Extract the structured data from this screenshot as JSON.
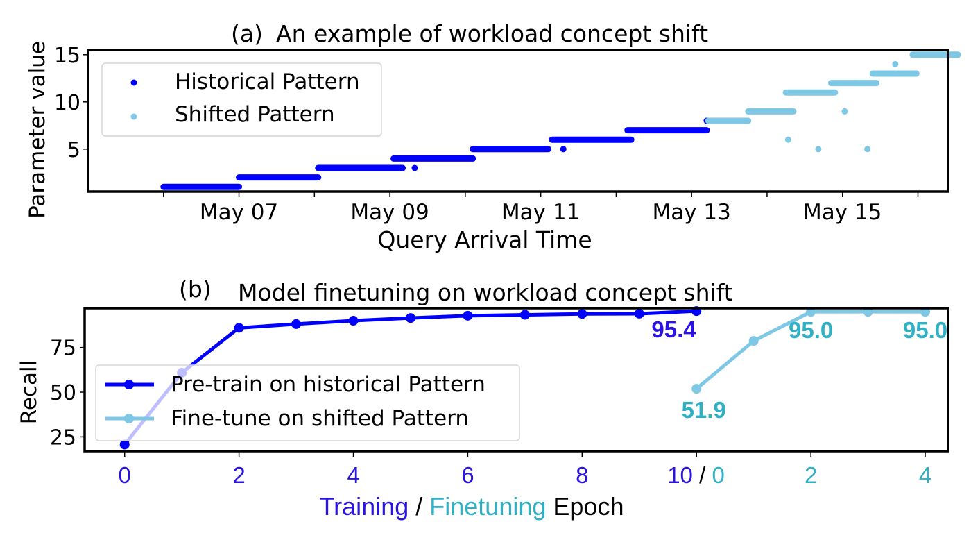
{
  "chart_data": [
    {
      "id": "a",
      "type": "scatter",
      "panel_label": "(a)",
      "title": "An example of workload concept shift",
      "xlabel": "Query Arrival Time",
      "ylabel": "Parameter value",
      "x_unit": "days since May 06",
      "xlim": [
        -1.0,
        10.4
      ],
      "ylim": [
        0.5,
        15.5
      ],
      "yticks": [
        5,
        10,
        15
      ],
      "xticks": [
        {
          "pos": 0,
          "label": ""
        },
        {
          "pos": 1,
          "label": "May 07"
        },
        {
          "pos": 2,
          "label": ""
        },
        {
          "pos": 3,
          "label": "May 09"
        },
        {
          "pos": 4,
          "label": ""
        },
        {
          "pos": 5,
          "label": "May 11"
        },
        {
          "pos": 6,
          "label": ""
        },
        {
          "pos": 7,
          "label": "May 13"
        },
        {
          "pos": 8,
          "label": ""
        },
        {
          "pos": 9,
          "label": "May 15"
        },
        {
          "pos": 10,
          "label": ""
        }
      ],
      "grid": false,
      "legend": {
        "position": "top-left",
        "entries": [
          {
            "label": "Historical Pattern",
            "color": "#0000ff"
          },
          {
            "label": "Shifted Pattern",
            "color": "#7ec8e6"
          }
        ]
      },
      "series": [
        {
          "name": "Historical Pattern",
          "color": "#0000ff",
          "segments": [
            {
              "x0": 0.0,
              "x1": 1.0,
              "y": 1
            },
            {
              "x0": 1.0,
              "x1": 2.05,
              "y": 2
            },
            {
              "x0": 2.05,
              "x1": 3.15,
              "y": 3
            },
            {
              "x0": 3.05,
              "x1": 4.1,
              "y": 4
            },
            {
              "x0": 4.1,
              "x1": 5.1,
              "y": 5
            },
            {
              "x0": 5.15,
              "x1": 6.2,
              "y": 6
            },
            {
              "x0": 6.15,
              "x1": 7.2,
              "y": 7
            },
            {
              "x0": 7.2,
              "x1": 7.22,
              "y": 8
            }
          ],
          "points": [
            {
              "x": 3.17,
              "y": 3
            },
            {
              "x": 3.33,
              "y": 3
            },
            {
              "x": 5.3,
              "y": 5
            }
          ]
        },
        {
          "name": "Shifted Pattern",
          "color": "#7ec8e6",
          "segments": [
            {
              "x0": 7.22,
              "x1": 7.75,
              "y": 8
            },
            {
              "x0": 7.75,
              "x1": 8.35,
              "y": 9
            },
            {
              "x0": 8.25,
              "x1": 8.9,
              "y": 11
            },
            {
              "x0": 8.85,
              "x1": 9.45,
              "y": 12
            },
            {
              "x0": 9.4,
              "x1": 9.98,
              "y": 13
            },
            {
              "x0": 9.93,
              "x1": 10.53,
              "y": 15
            }
          ],
          "points": [
            {
              "x": 8.28,
              "y": 6
            },
            {
              "x": 8.68,
              "y": 5
            },
            {
              "x": 8.88,
              "y": 11
            },
            {
              "x": 9.03,
              "y": 9
            },
            {
              "x": 9.17,
              "y": 12
            },
            {
              "x": 9.33,
              "y": 5
            },
            {
              "x": 9.7,
              "y": 14
            }
          ]
        }
      ]
    },
    {
      "id": "b",
      "type": "line",
      "panel_label": "(b)",
      "title": "Model finetuning on workload concept shift",
      "ylabel": "Recall",
      "xlabel_parts": [
        {
          "text": "Training",
          "color": "#2a12e0"
        },
        {
          "text": " / ",
          "color": "#000000"
        },
        {
          "text": "Finetuning",
          "color": "#2fb0c4"
        },
        {
          "text": " Epoch",
          "color": "#000000"
        }
      ],
      "ylim": [
        17,
        97
      ],
      "yticks": [
        25,
        50,
        75
      ],
      "xlim": [
        -0.7,
        14.4
      ],
      "xticks": [
        {
          "pos": 0,
          "parts": [
            {
              "text": "0",
              "color": "#2a12e0"
            }
          ]
        },
        {
          "pos": 2,
          "parts": [
            {
              "text": "2",
              "color": "#2a12e0"
            }
          ]
        },
        {
          "pos": 4,
          "parts": [
            {
              "text": "4",
              "color": "#2a12e0"
            }
          ]
        },
        {
          "pos": 6,
          "parts": [
            {
              "text": "6",
              "color": "#2a12e0"
            }
          ]
        },
        {
          "pos": 8,
          "parts": [
            {
              "text": "8",
              "color": "#2a12e0"
            }
          ]
        },
        {
          "pos": 10,
          "parts": [
            {
              "text": "10",
              "color": "#2a12e0"
            },
            {
              "text": " / ",
              "color": "#000000"
            },
            {
              "text": "0",
              "color": "#2fb0c4"
            }
          ]
        },
        {
          "pos": 12,
          "parts": [
            {
              "text": "2",
              "color": "#2fb0c4"
            }
          ]
        },
        {
          "pos": 14,
          "parts": [
            {
              "text": "4",
              "color": "#2fb0c4"
            }
          ]
        }
      ],
      "grid": false,
      "legend": {
        "position": "lower-left",
        "entries": [
          {
            "label": "Pre-train on historical Pattern",
            "color": "#0000ff"
          },
          {
            "label": "Fine-tune on shifted Pattern",
            "color": "#7ec8e6"
          }
        ]
      },
      "series": [
        {
          "name": "Pre-train on historical Pattern",
          "color": "#0000ff",
          "x": [
            0,
            1,
            2,
            3,
            4,
            5,
            6,
            7,
            8,
            9,
            10
          ],
          "values": [
            20.7,
            60.9,
            86.0,
            88.1,
            90.0,
            91.5,
            92.8,
            93.3,
            93.8,
            93.9,
            95.4
          ]
        },
        {
          "name": "Fine-tune on shifted Pattern",
          "color": "#7ec8e6",
          "x": [
            10,
            11,
            12,
            13,
            14
          ],
          "epochs": [
            0,
            1,
            2,
            3,
            4
          ],
          "values": [
            51.9,
            78.7,
            95.0,
            95.0,
            95.0
          ]
        }
      ],
      "annotations": [
        {
          "text": "95.4",
          "x": 9.7,
          "y": 95.4,
          "color": "#2a12e0"
        },
        {
          "text": "51.9",
          "x": 10.2,
          "y": 51.9,
          "color": "#2fb0c4"
        },
        {
          "text": "95.0",
          "x": 12.0,
          "y": 95.0,
          "color": "#2fb0c4"
        },
        {
          "text": "95.0",
          "x": 14.0,
          "y": 95.0,
          "color": "#2fb0c4"
        }
      ]
    }
  ]
}
